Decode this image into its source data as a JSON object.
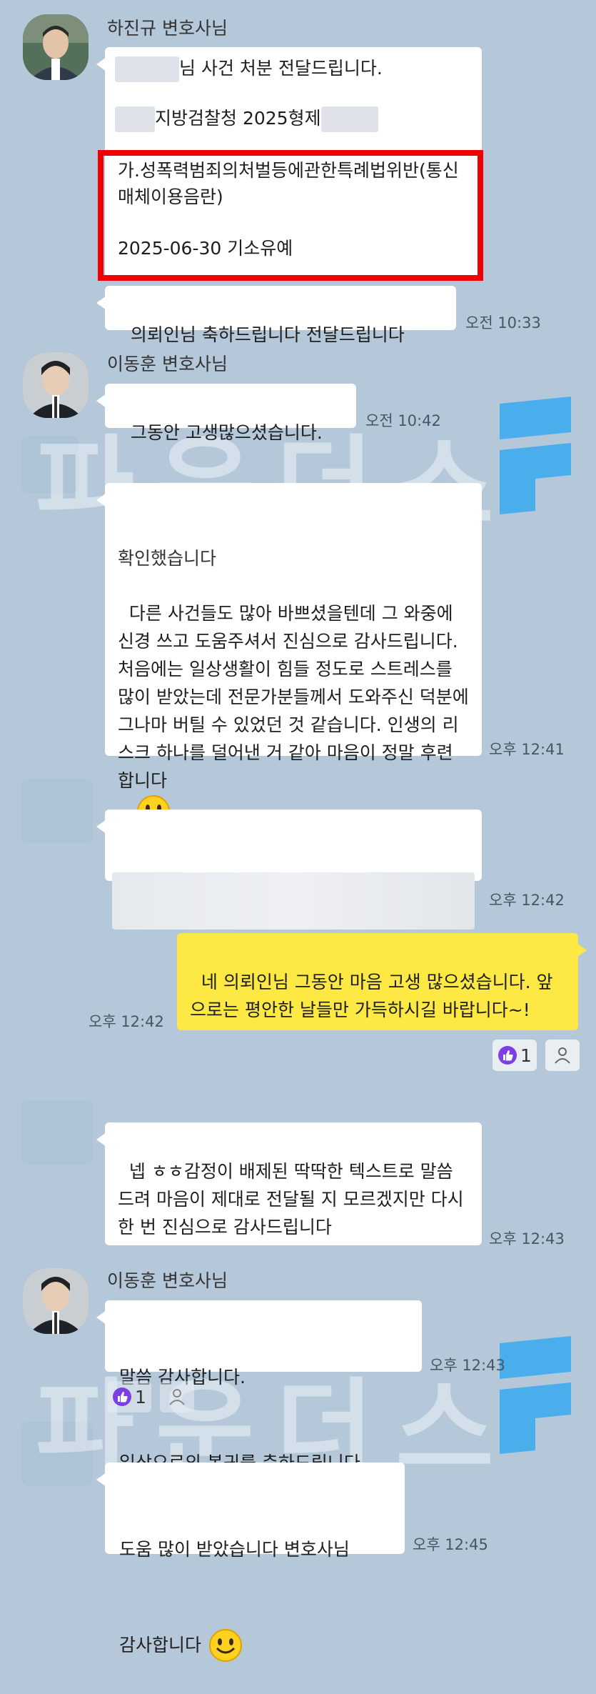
{
  "watermark": {
    "text": "파운더스"
  },
  "messages": {
    "m1": {
      "sender": "하진규 변호사님",
      "line1_suffix": "님 사건 처분 전달드립니다.",
      "line2_middle": "지방검찰청 2025형제",
      "charge": "가.성폭력범죄의처벌등에관한특례법위반(통신매체이용음란)",
      "result": "2025-06-30 기소유예"
    },
    "m2": {
      "text": "의뢰인님 축하드립니다 전달드립니다",
      "time": "오전 10:33"
    },
    "m3": {
      "sender": "이동훈 변호사님",
      "text": "그동안 고생많으셨습니다.",
      "time": "오전 10:42"
    },
    "m4": {
      "header": "확인했습니다",
      "text": "다른 사건들도 많아 바쁘셨을텐데 그 와중에 신경 쓰고 도움주셔서 진심으로 감사드립니다. 처음에는 일상생활이 힘들 정도로 스트레스를 많이 받았는데 전문가분들께서 도와주신 덕분에 그나마 버틸 수 있었던 것 같습니다. 인생의 리스크 하나를 덜어낸 거 같아 마음이 정말 후련합니다",
      "time": "오후 12:41"
    },
    "m5": {
      "time": "오후 12:42"
    },
    "m6": {
      "text": "네 의뢰인님 그동안 마음 고생 많으셨습니다. 앞으로는 평안한 날들만 가득하시길 바랍니다~!",
      "time": "오후 12:42",
      "reaction_count": "1"
    },
    "m7": {
      "text": "넵 ㅎㅎ감정이 배제된 딱딱한 텍스트로 말씀드려 마음이 제대로 전달될 지 모르겠지만 다시 한 번 진심으로 감사드립니다",
      "time": "오후 12:43"
    },
    "m8": {
      "sender": "이동훈 변호사님",
      "line1": "말씀 감사합니다.",
      "line2": "일상으로의 복귀를 축하드립니다.",
      "time": "오후 12:43",
      "reaction_count": "1"
    },
    "m9": {
      "line1": "도움 많이 받았습니다 변호사님",
      "line2": "감사합니다",
      "time": "오후 12:45"
    }
  },
  "colors": {
    "background": "#b4c8da",
    "my_bubble": "#fde844",
    "highlight_box": "#f00000",
    "like": "#7b3fe4"
  }
}
